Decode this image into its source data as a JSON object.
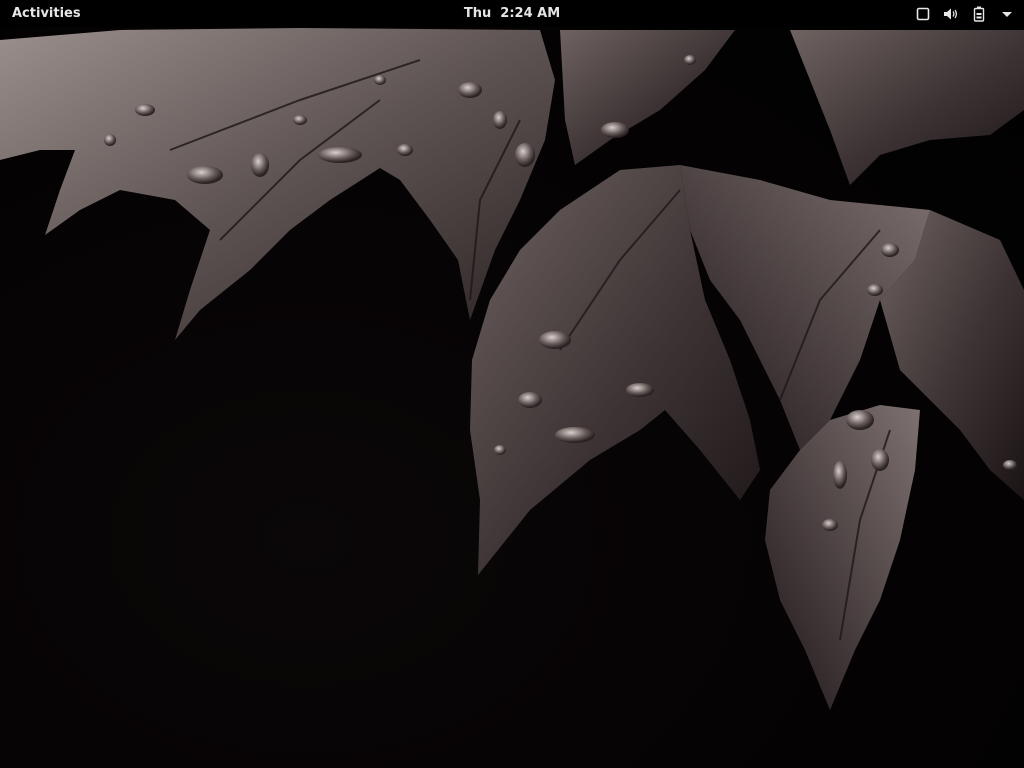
{
  "top_bar": {
    "activities_label": "Activities",
    "clock": {
      "day": "Thu",
      "time": "2:24 AM"
    },
    "status_icons": [
      "window-icon",
      "volume-icon",
      "battery-icon",
      "system-menu-arrow-icon"
    ]
  },
  "desktop": {
    "wallpaper": "dark leaves with water droplets"
  },
  "colors": {
    "topbar_bg": "#000000",
    "topbar_text": "#e6e6e6",
    "wallpaper_bg": "#050304",
    "leaf_light": "#8a7f7d",
    "leaf_dark": "#2a2224"
  }
}
